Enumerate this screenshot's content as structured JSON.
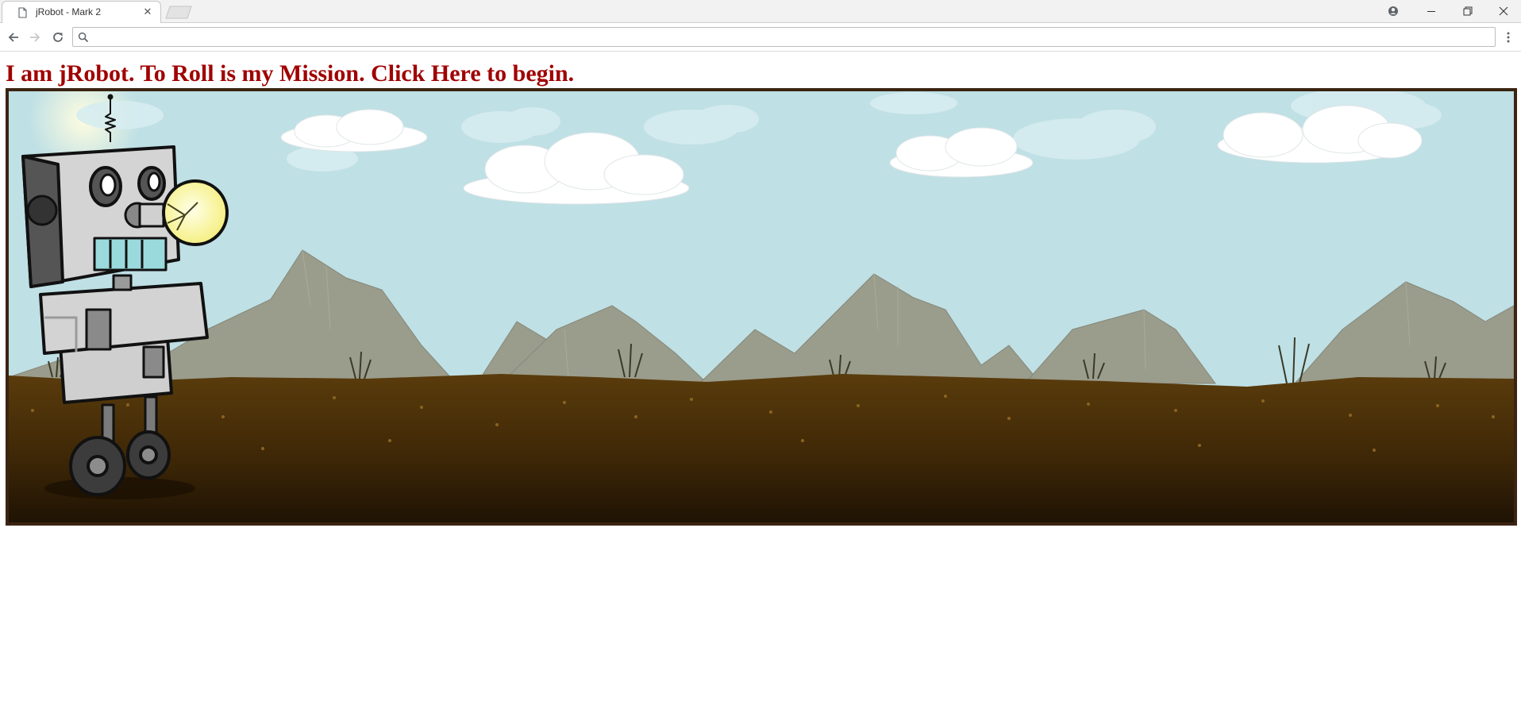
{
  "browser": {
    "tab": {
      "title": "jRobot - Mark 2",
      "close_glyph": "✕",
      "icon": "page-icon"
    },
    "window_controls": [
      "account-icon",
      "minimize-icon",
      "restore-icon",
      "close-icon"
    ],
    "toolbar": {
      "back_icon": "back-arrow-icon",
      "forward_icon": "forward-arrow-icon",
      "reload_icon": "reload-icon",
      "omnibox_value": "",
      "omnibox_icon": "search-icon",
      "menu_icon": "more-vert-icon"
    }
  },
  "page": {
    "heading": "I am jRobot. To Roll is my Mission. Click Here to begin.",
    "heading_color": "#a00000",
    "banner": {
      "description_icon": "robot-landscape-illustration",
      "sky_color": "#bfe0e5",
      "mountain_color": "#9a9c8c",
      "ground_color": "#4a3008",
      "frame_color": "#3b2412"
    }
  }
}
